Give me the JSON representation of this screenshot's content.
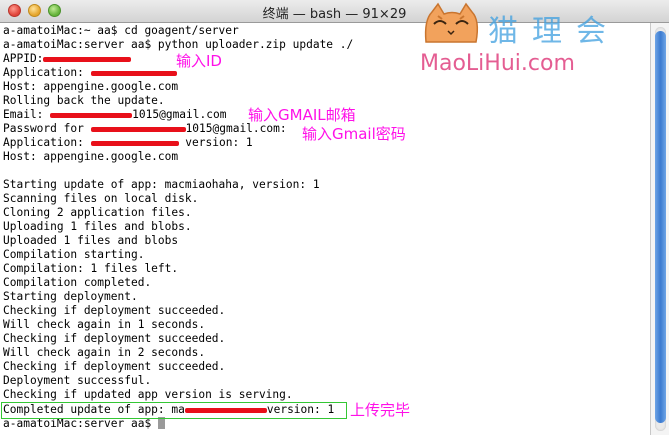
{
  "window": {
    "title": "终端 — bash — 91×29"
  },
  "watermark": {
    "chinese": "猫理会",
    "english": "MaoLiHui.com"
  },
  "terminal": {
    "lines": [
      "a-amatoiMac:~ aa$ cd goagent/server",
      "a-amatoiMac:server aa$ python uploader.zip update ./",
      "APPID:",
      "Application: ",
      "Host: appengine.google.com",
      "Rolling back the update.",
      "Email: ",
      "Password for ",
      "Application: ",
      "Host: appengine.google.com",
      "",
      "Starting update of app: macmiaohaha, version: 1",
      "Scanning files on local disk.",
      "Cloning 2 application files.",
      "Uploading 1 files and blobs.",
      "Uploaded 1 files and blobs",
      "Compilation starting.",
      "Compilation: 1 files left.",
      "Compilation completed.",
      "Starting deployment.",
      "Checking if deployment succeeded.",
      "Will check again in 1 seconds.",
      "Checking if deployment succeeded.",
      "Will check again in 2 seconds.",
      "Checking if deployment succeeded.",
      "Deployment successful.",
      "Checking if updated app version is serving.",
      "Completed update of app: ma",
      "a-amatoiMac:server aa$ "
    ],
    "email_suffix": "1015@gmail.com",
    "password_suffix": "1015@gmail.com:",
    "application_version": " version: 1",
    "completed_version": "version: 1"
  },
  "annotations": {
    "appid": "输入ID",
    "gmail": "输入GMAIL邮箱",
    "password": "输入Gmail密码",
    "complete": "上传完毕"
  },
  "colors": {
    "annotation": "#ff10e8",
    "redaction": "#e8101a",
    "highlight_box": "#34c734",
    "scroll_thumb": "#3b7ad0"
  }
}
